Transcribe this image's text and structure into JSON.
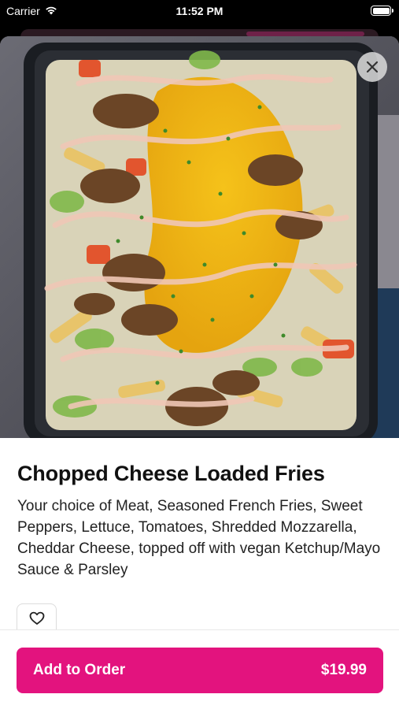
{
  "status_bar": {
    "carrier": "Carrier",
    "time": "11:52 PM"
  },
  "item": {
    "title": "Chopped Cheese Loaded Fries",
    "description": "Your choice of Meat, Seasoned French Fries, Sweet Peppers, Lettuce, Tomatoes, Shredded Mozzarella, Cheddar Cheese, topped off with vegan Ketchup/Mayo Sauce & Parsley",
    "image_icon": "food-photo"
  },
  "actions": {
    "add_label": "Add to Order",
    "price": "$19.99",
    "favorite_icon": "heart-icon",
    "close_icon": "close-icon"
  },
  "colors": {
    "accent": "#e3137e"
  }
}
